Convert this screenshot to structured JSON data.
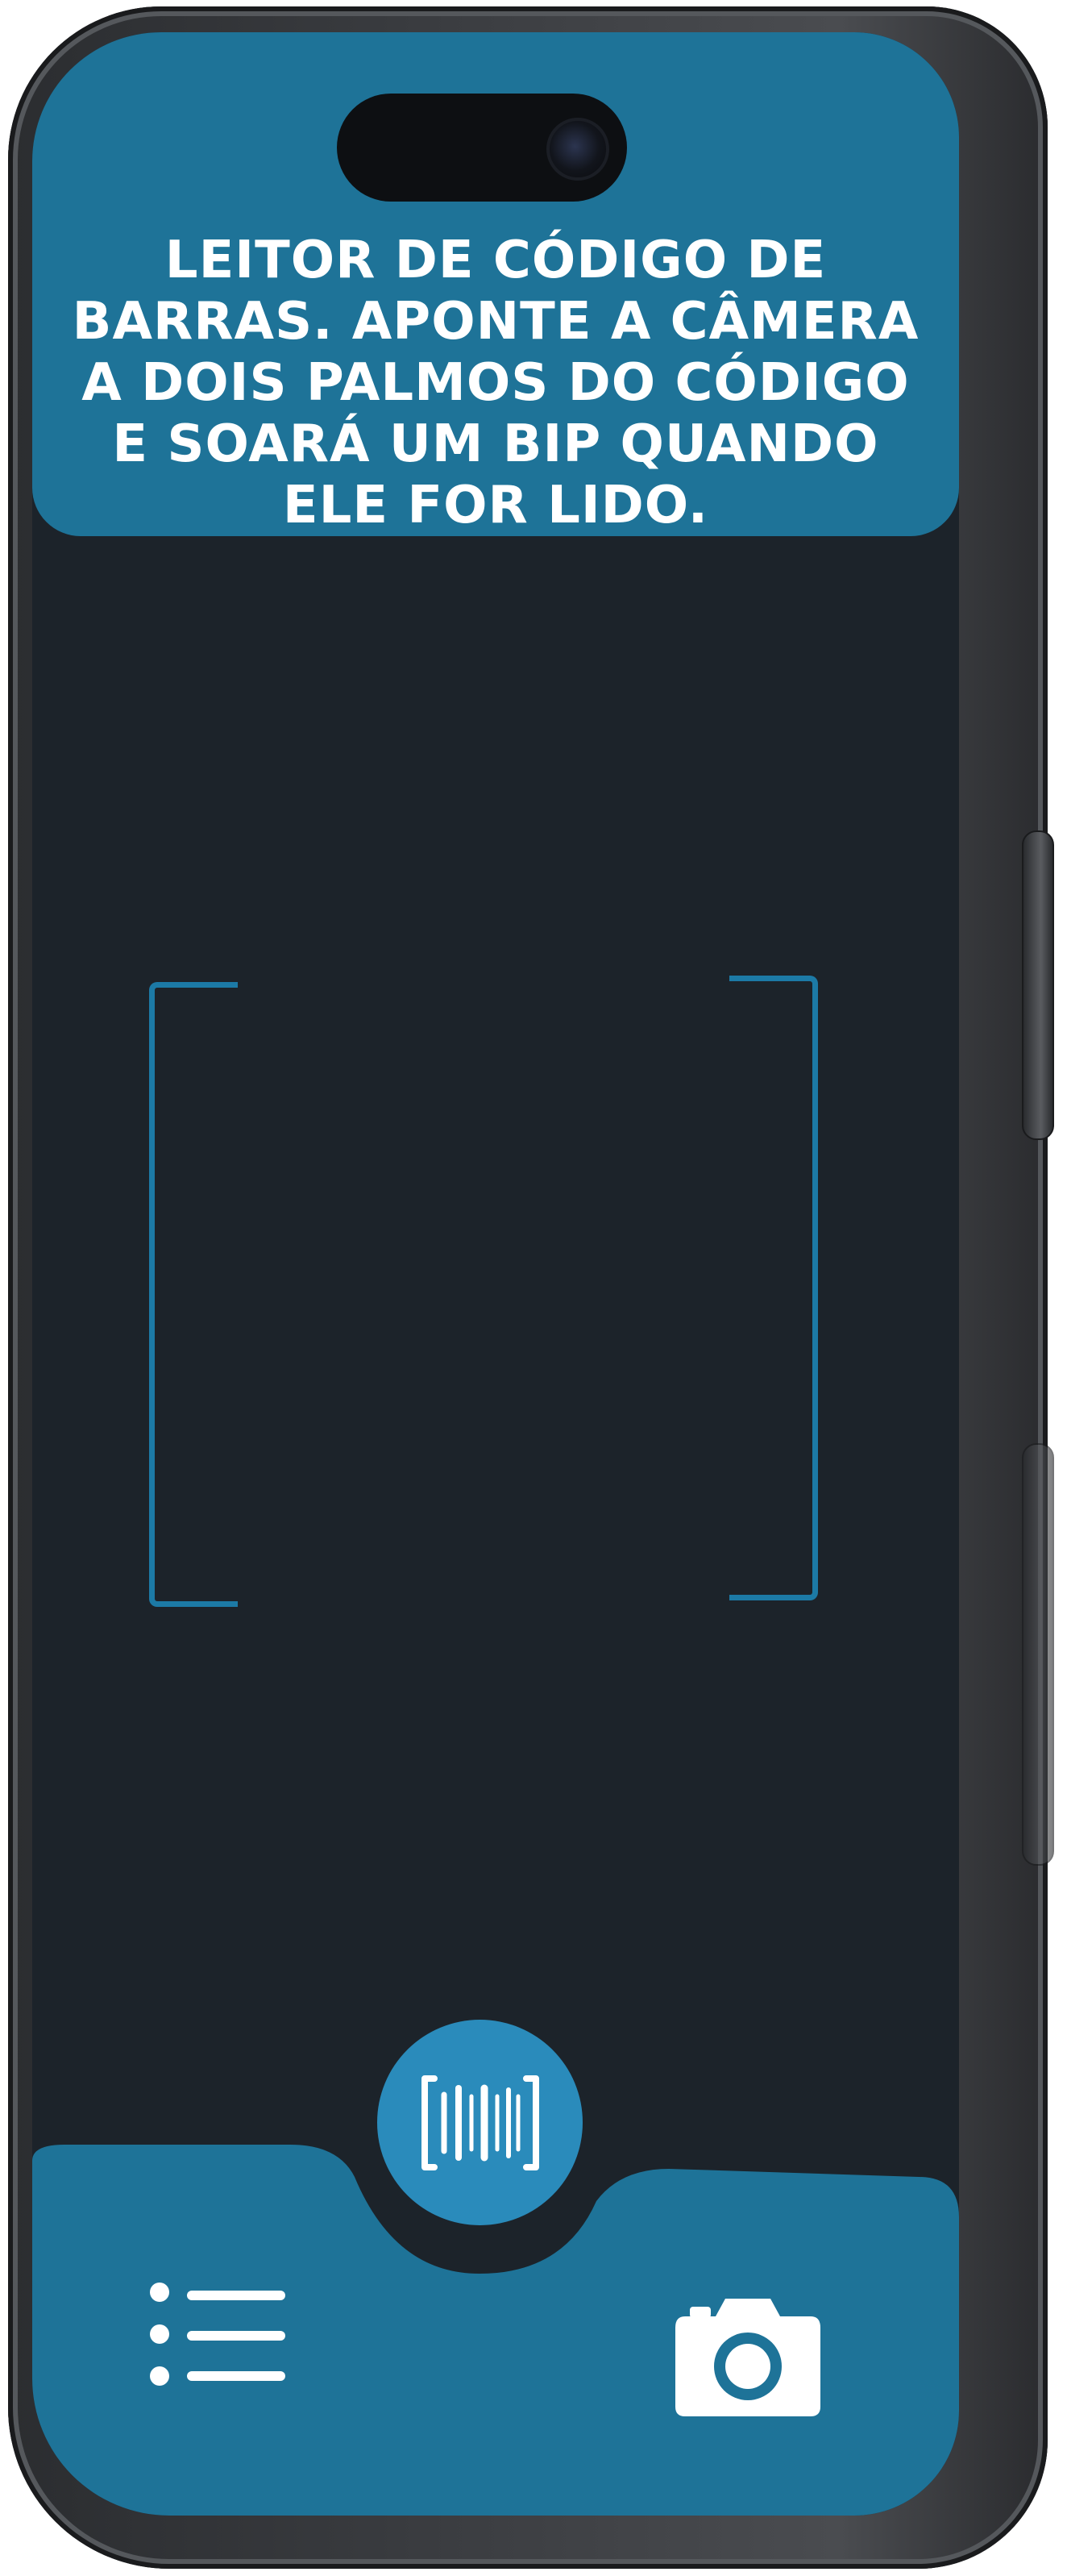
{
  "screen": {
    "instructions": "LEITOR DE CÓDIGO DE BARRAS. APONTE A CÂMERA A DOIS PALMOS DO CÓDIGO E SOARÁ UM BIP QUANDO ELE FOR LIDO."
  },
  "icons": {
    "scan": "barcode-scan-icon",
    "menu": "list-menu-icon",
    "camera": "camera-icon"
  },
  "colors": {
    "header_background": "#1e7398",
    "screen_background": "#1c232a",
    "accent": "#2a8bbb",
    "frame_bracket": "#1c7aa6",
    "icon": "#ffffff"
  }
}
